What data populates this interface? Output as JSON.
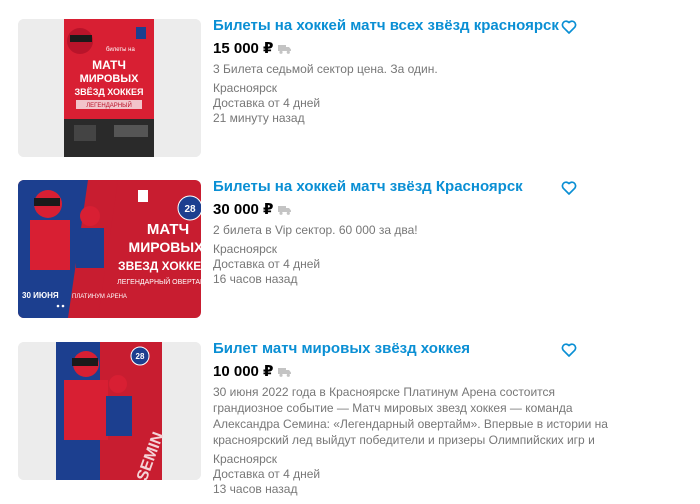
{
  "listings": [
    {
      "title": "Билеты на хоккей матч всех звёзд красноярск",
      "price": "15 000 ₽",
      "description": "3 Билета седьмой сектор цена. За один.",
      "city": "Красноярск",
      "delivery": "Доставка от 4 дней",
      "posted": "21 минуту назад",
      "image_text": [
        "МАТЧ",
        "МИРОВЫХ",
        "ЗВЁЗД ХОККЕЯ",
        "ЛЕГЕНДАРНЫЙ",
        "билеты на"
      ]
    },
    {
      "title": "Билеты на хоккей матч звёзд Красноярск",
      "price": "30 000 ₽",
      "description": "2 билета в Vip сектор. 60 000 за два!",
      "city": "Красноярск",
      "delivery": "Доставка от 4 дней",
      "posted": "16 часов назад",
      "image_text": [
        "МАТЧ",
        "МИРОВЫХ",
        "ЗВЕЗД ХОККЕЯ",
        "ЛЕГЕНДАРНЫЙ ОВЕРТАЙМ",
        "30 ИЮНЯ",
        "ПЛАТИНУМ АРЕНА",
        "28"
      ]
    },
    {
      "title": "Билет матч мировых звёзд хоккея",
      "price": "10 000 ₽",
      "description_lines": [
        "30 июня 2022 года в Красноярске Платинум Арена состоится",
        "грандиозное событие — Матч мировых звезд хоккея — команда",
        "Александра Семина: «Легендарный овертайм». Впервые в истории на",
        "красноярский лед выйдут победители и призеры Олимпийских игр и"
      ],
      "city": "Красноярск",
      "delivery": "Доставка от 4 дней",
      "posted": "13 часов назад",
      "image_text": [
        "28",
        "SEMIN"
      ]
    }
  ],
  "colors": {
    "title": "#0a8fd4",
    "muted": "#777777",
    "poster_red": "#d81f33",
    "poster_blue": "#1c3f8f"
  },
  "icons": {
    "favorite": "heart-outline-icon",
    "delivery": "truck-icon"
  }
}
